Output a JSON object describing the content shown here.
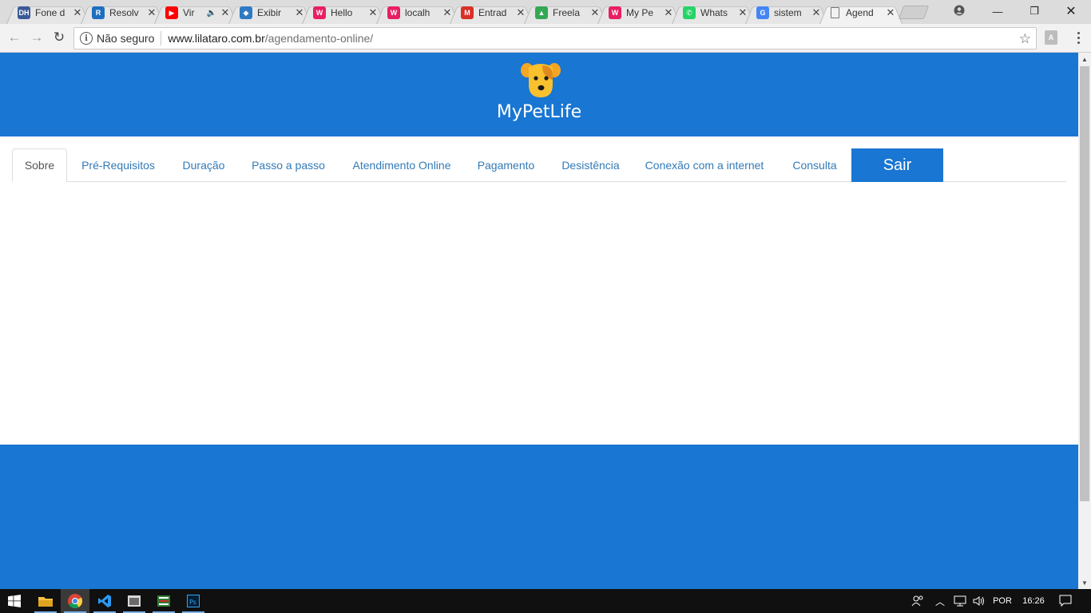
{
  "browser": {
    "tabs": [
      {
        "title": "Fone d",
        "favicon": "dh-icon",
        "color": "#3b5998",
        "glyph": "DH"
      },
      {
        "title": "Resolv",
        "favicon": "stack-icon",
        "color": "#1e6fbf",
        "glyph": "R"
      },
      {
        "title": "Vir",
        "favicon": "youtube-icon",
        "color": "#ff0000",
        "glyph": "▶",
        "audio": "🔈"
      },
      {
        "title": "Exibir",
        "favicon": "box-icon",
        "color": "#2e7bc4",
        "glyph": "◆"
      },
      {
        "title": "Hello",
        "favicon": "wix-icon",
        "color": "#e91e63",
        "glyph": "W"
      },
      {
        "title": "localh",
        "favicon": "wix-icon",
        "color": "#e91e63",
        "glyph": "W"
      },
      {
        "title": "Entrad",
        "favicon": "gmail-icon",
        "color": "#d93025",
        "glyph": "M"
      },
      {
        "title": "Freela",
        "favicon": "drive-icon",
        "color": "#34a853",
        "glyph": "▲"
      },
      {
        "title": "My Pe",
        "favicon": "wix-icon",
        "color": "#e91e63",
        "glyph": "W"
      },
      {
        "title": "Whats",
        "favicon": "whatsapp-icon",
        "color": "#25d366",
        "glyph": "✆"
      },
      {
        "title": "sistem",
        "favicon": "google-icon",
        "color": "#4285f4",
        "glyph": "G"
      },
      {
        "title": "Agend",
        "favicon": "page-icon",
        "color": "#ffffff",
        "glyph": "",
        "active": true
      }
    ],
    "omnibox": {
      "security": "Não seguro",
      "host": "www.lilataro.com.br",
      "path": "/agendamento-online/"
    }
  },
  "site": {
    "brand": "MyPetLife",
    "tabs": [
      {
        "label": "Sobre",
        "active": true
      },
      {
        "label": "Pré-Requisitos"
      },
      {
        "label": "Duração"
      },
      {
        "label": "Passo a passo"
      },
      {
        "label": "Atendimento Online"
      },
      {
        "label": "Pagamento"
      },
      {
        "label": "Desistência"
      },
      {
        "label": "Conexão com a internet"
      },
      {
        "label": "Consulta"
      }
    ],
    "logout": "Sair",
    "accent": "#1976d2",
    "logo_color": "#f9c12e"
  },
  "taskbar": {
    "language": "POR",
    "time": "16:26"
  }
}
